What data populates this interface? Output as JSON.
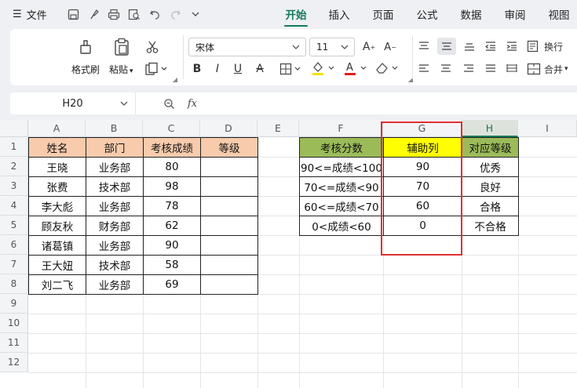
{
  "menubar": {
    "menu_label": "文件",
    "tabs": [
      {
        "label": "开始",
        "active": true
      },
      {
        "label": "插入",
        "active": false
      },
      {
        "label": "页面",
        "active": false
      },
      {
        "label": "公式",
        "active": false
      },
      {
        "label": "数据",
        "active": false
      },
      {
        "label": "审阅",
        "active": false
      },
      {
        "label": "视图",
        "active": false
      }
    ]
  },
  "ribbon": {
    "format_painter_label": "格式刷",
    "paste_label": "粘贴",
    "font_name": "宋体",
    "font_size": "11",
    "wrap_label": "换行",
    "merge_label": "合并"
  },
  "formula_bar": {
    "cell_ref": "H20",
    "fx_label": "fx",
    "formula": ""
  },
  "sheet": {
    "columns": [
      "A",
      "B",
      "C",
      "D",
      "E",
      "F",
      "G",
      "H",
      "I"
    ],
    "selected_column": "H",
    "rows": [
      "1",
      "2",
      "3",
      "4",
      "5",
      "6",
      "7",
      "8",
      "9",
      "10",
      "11",
      "12"
    ],
    "table1": {
      "headers": [
        "姓名",
        "部门",
        "考核成绩",
        "等级"
      ],
      "rows": [
        [
          "王晓",
          "业务部",
          "80",
          ""
        ],
        [
          "张费",
          "技术部",
          "98",
          ""
        ],
        [
          "李大彪",
          "业务部",
          "78",
          ""
        ],
        [
          "顾友秋",
          "财务部",
          "62",
          ""
        ],
        [
          "诸葛镇",
          "业务部",
          "90",
          ""
        ],
        [
          "王大妞",
          "技术部",
          "58",
          ""
        ],
        [
          "刘二飞",
          "业务部",
          "69",
          ""
        ]
      ]
    },
    "table2": {
      "headers": [
        "考核分数",
        "辅助列",
        "对应等级"
      ],
      "rows": [
        [
          "90<=成绩<100",
          "90",
          "优秀"
        ],
        [
          "70<=成绩<90",
          "70",
          "良好"
        ],
        [
          "60<=成绩<70",
          "60",
          "合格"
        ],
        [
          "0<成绩<60",
          "0",
          "不合格"
        ]
      ]
    }
  },
  "colors": {
    "accent": "#127a5a",
    "header_peach": "#f8cbad",
    "header_green": "#9bbb59",
    "header_yellow": "#ffff00",
    "highlight_red": "#e03030"
  }
}
